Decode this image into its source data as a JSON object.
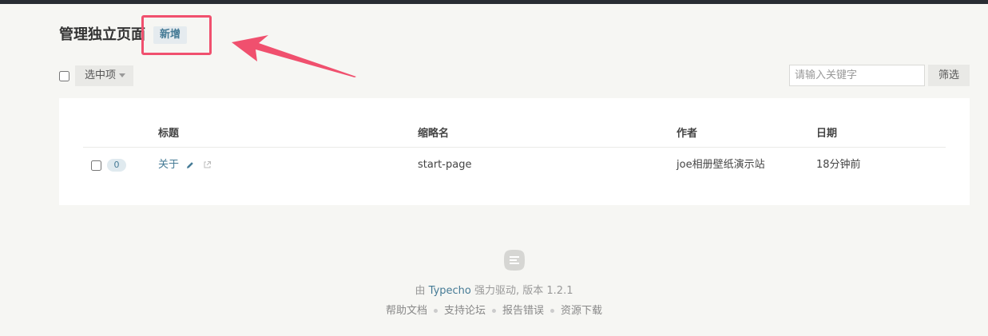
{
  "header": {
    "title": "管理独立页面",
    "new_button": "新增"
  },
  "toolbar": {
    "select_items_label": "选中项",
    "search_placeholder": "请输入关键字",
    "filter_label": "筛选"
  },
  "table": {
    "columns": [
      "标题",
      "缩略名",
      "作者",
      "日期"
    ],
    "rows": [
      {
        "comments": "0",
        "title": "关于",
        "slug": "start-page",
        "author": "joe相册壁纸演示站",
        "date": "18分钟前"
      }
    ]
  },
  "footer": {
    "powered_prefix": "由",
    "powered_link": "Typecho",
    "powered_suffix": "强力驱动, 版本 1.2.1",
    "links": [
      "帮助文档",
      "支持论坛",
      "报告错误",
      "资源下载"
    ]
  },
  "colors": {
    "link": "#467b96",
    "highlight": "#f0506e",
    "topbar": "#292d33"
  }
}
